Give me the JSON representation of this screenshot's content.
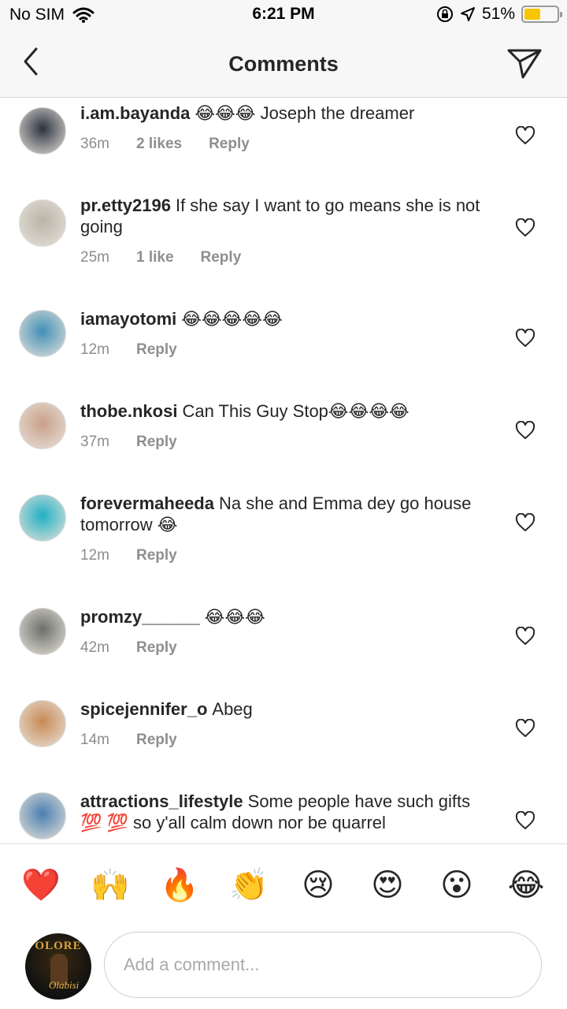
{
  "status_bar": {
    "carrier": "No SIM",
    "time": "6:21 PM",
    "battery": "51%",
    "battery_level": 0.51,
    "icons": [
      "wifi-icon",
      "orientation-lock-icon",
      "location-arrow-icon",
      "battery-icon"
    ]
  },
  "nav": {
    "title": "Comments",
    "back_icon": "chevron-left-icon",
    "send_icon": "paper-plane-icon"
  },
  "comments": [
    {
      "user": "i.am.bayanda",
      "text": "😂😂😂 Joseph the dreamer",
      "time": "36m",
      "likes": "2 likes",
      "reply": "Reply",
      "avatar_color": "#2b3340"
    },
    {
      "user": "pr.etty2196",
      "text": "If she say I want to go means she is not going",
      "time": "25m",
      "likes": "1 like",
      "reply": "Reply",
      "avatar_color": "#b9b4a8"
    },
    {
      "user": "iamayotomi",
      "text": "😂😂😂😂😂",
      "time": "12m",
      "likes": "",
      "reply": "Reply",
      "avatar_color": "#3f8fb6"
    },
    {
      "user": "thobe.nkosi",
      "text": "Can This Guy Stop😂😂😂😂",
      "time": "37m",
      "likes": "",
      "reply": "Reply",
      "avatar_color": "#c9a08a"
    },
    {
      "user": "forevermaheeda",
      "text": "Na she and Emma dey go house tomorrow 😂",
      "time": "12m",
      "likes": "",
      "reply": "Reply",
      "avatar_color": "#1fb0c4"
    },
    {
      "user": "promzy______",
      "text": "😂😂😂",
      "time": "42m",
      "likes": "",
      "reply": "Reply",
      "avatar_color": "#6b6f6a"
    },
    {
      "user": "spicejennifer_o",
      "text": "Abeg",
      "time": "14m",
      "likes": "",
      "reply": "Reply",
      "avatar_color": "#c88a55"
    },
    {
      "user": "attractions_lifestyle",
      "text": "Some people have such gifts 💯 💯  so y'all calm down nor be quarrel",
      "time": "",
      "likes": "",
      "reply": "",
      "avatar_color": "#4a7fb0"
    }
  ],
  "emoji_bar": [
    "❤️",
    "🙌",
    "🔥",
    "👏",
    "😢",
    "😍",
    "😮",
    "😂"
  ],
  "compose": {
    "placeholder": "Add a comment...",
    "avatar_text": "OLORE",
    "avatar_signature": "Olabisi"
  }
}
